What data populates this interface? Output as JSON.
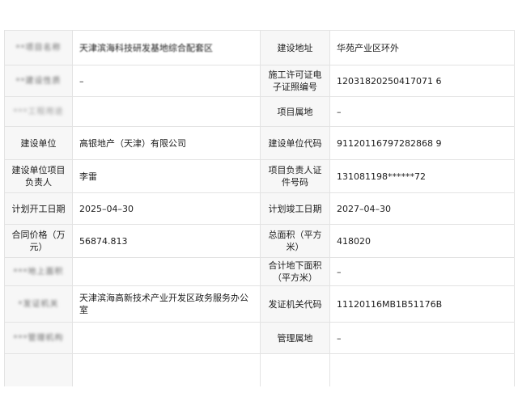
{
  "rows": [
    {
      "left_label": "**项目名称",
      "left_value": "天津滨海科技研发基地综合配套区",
      "right_label": "建设地址",
      "right_value": "华苑产业区环外"
    },
    {
      "left_label": "**建设性质",
      "left_value": "–",
      "right_label": "施工许可证电子证照编号",
      "right_value": "12031820250417071 6"
    },
    {
      "left_label": "***工程用途",
      "left_value": "",
      "right_label": "项目属地",
      "right_value": "–"
    },
    {
      "left_label": "建设单位",
      "left_value": "高银地产（天津）有限公司",
      "right_label": "建设单位代码",
      "right_value": "91120116797282868 9"
    },
    {
      "left_label": "建设单位项目负责人",
      "left_value": "李雷",
      "right_label": "项目负责人证件号码",
      "right_value": "131081198******72"
    },
    {
      "left_label": "计划开工日期",
      "left_value": "2025–04–30",
      "right_label": "计划竣工日期",
      "right_value": "2027–04–30"
    },
    {
      "left_label": "合同价格（万元）",
      "left_value": "56874.813",
      "right_label": "总面积（平方米）",
      "right_value": "418020"
    },
    {
      "left_label": "***地上面积",
      "left_value": "",
      "right_label": "合计地下面积（平方米）",
      "right_value": "–"
    },
    {
      "left_label": "*发证机关",
      "left_value": "天津滨海高新技术产业开发区政务服务办公室",
      "right_label": "发证机关代码",
      "right_value": "11120116MB1B51176B"
    },
    {
      "left_label": "***管理机构",
      "left_value": "",
      "right_label": "管理属地",
      "right_value": "–"
    },
    {
      "left_label": "",
      "left_value": "",
      "right_label": "",
      "right_value": ""
    }
  ]
}
